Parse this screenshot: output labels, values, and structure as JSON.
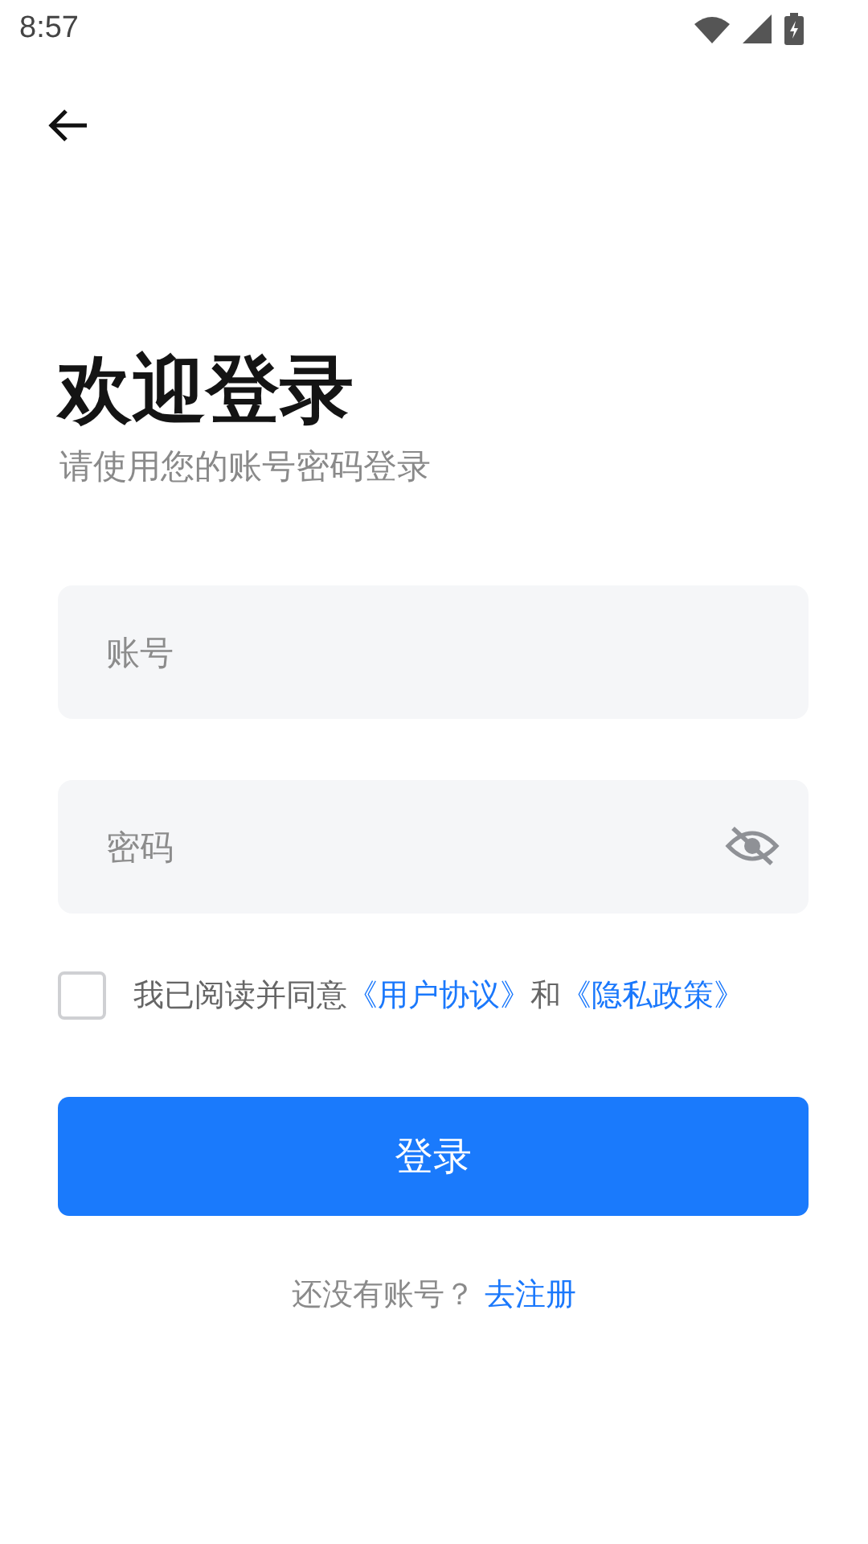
{
  "status_bar": {
    "time": "8:57"
  },
  "title": "欢迎登录",
  "subtitle": "请使用您的账号密码登录",
  "fields": [
    {
      "kind": "text",
      "placeholder": "账号"
    },
    {
      "kind": "password",
      "placeholder": "密码"
    }
  ],
  "agreement": {
    "checked": false,
    "text": "我已阅读并同意",
    "link_1": "《用户协议》",
    "joiner": "和",
    "link_2": "《隐私政策》"
  },
  "login_button": "登录",
  "register": {
    "prompt": "还没有账号？",
    "link": "去注册"
  }
}
